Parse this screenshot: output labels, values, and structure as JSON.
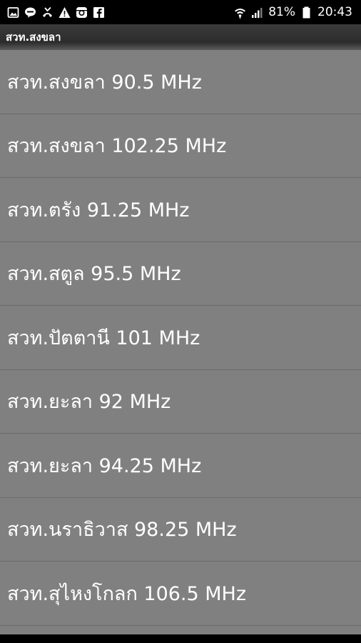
{
  "status_bar": {
    "battery_percent": "81%",
    "time": "20:43",
    "left_icons": [
      "gallery-icon",
      "line-chat-icon",
      "missed-call-icon",
      "warning-icon",
      "instagram-icon",
      "facebook-icon"
    ],
    "right_icons": [
      "wifi-icon",
      "signal-icon",
      "battery-icon"
    ]
  },
  "app": {
    "title": "สวท.สงขลา"
  },
  "stations": [
    {
      "label": "สวท.สงขลา 90.5 MHz"
    },
    {
      "label": "สวท.สงขลา 102.25 MHz"
    },
    {
      "label": "สวท.ตรัง 91.25 MHz"
    },
    {
      "label": "สวท.สตูล 95.5 MHz"
    },
    {
      "label": "สวท.ปัตตานี 101 MHz"
    },
    {
      "label": "สวท.ยะลา 92 MHz"
    },
    {
      "label": "สวท.ยะลา 94.25 MHz"
    },
    {
      "label": "สวท.นราธิวาส 98.25 MHz"
    },
    {
      "label": "สวท.สุไหงโกลก 106.5 MHz"
    }
  ],
  "colors": {
    "list_background": "#808080",
    "divider": "#6a6a6a",
    "status_bar": "#000000",
    "text": "#ffffff"
  }
}
